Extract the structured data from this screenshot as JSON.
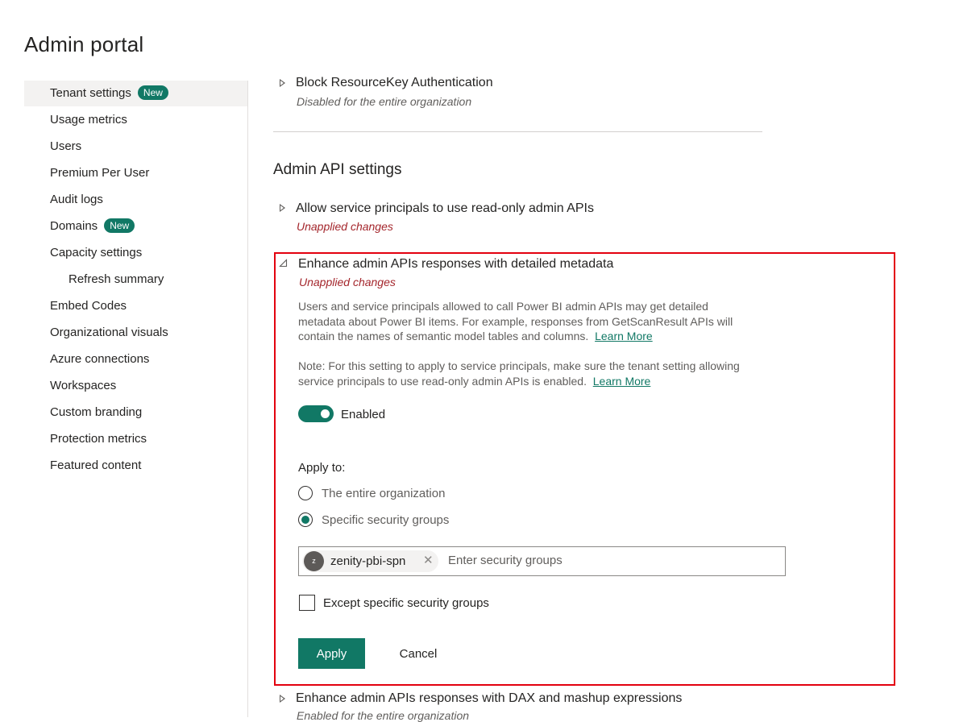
{
  "page": {
    "title": "Admin portal"
  },
  "sidebar": {
    "items": [
      {
        "label": "Tenant settings",
        "badge": "New"
      },
      {
        "label": "Usage metrics"
      },
      {
        "label": "Users"
      },
      {
        "label": "Premium Per User"
      },
      {
        "label": "Audit logs"
      },
      {
        "label": "Domains",
        "badge": "New"
      },
      {
        "label": "Capacity settings"
      },
      {
        "label": "Refresh summary"
      },
      {
        "label": "Embed Codes"
      },
      {
        "label": "Organizational visuals"
      },
      {
        "label": "Azure connections"
      },
      {
        "label": "Workspaces"
      },
      {
        "label": "Custom branding"
      },
      {
        "label": "Protection metrics"
      },
      {
        "label": "Featured content"
      }
    ]
  },
  "main": {
    "prev_setting": {
      "title": "Block ResourceKey Authentication",
      "status": "Disabled for the entire organization"
    },
    "section_heading": "Admin API settings",
    "setting_1": {
      "title": "Allow service principals to use read-only admin APIs",
      "status": "Unapplied changes"
    },
    "setting_2": {
      "title": "Enhance admin APIs responses with detailed metadata",
      "status": "Unapplied changes",
      "desc_1_line_1": "Users and service principals allowed to call Power BI admin APIs may get detailed",
      "desc_1_line_2": "metadata about Power BI items. For example, responses from GetScanResult APIs will",
      "desc_1_line_3": "contain the names of semantic model tables and columns.",
      "desc_1_link": "Learn More",
      "desc_2_line_1": "Note: For this setting to apply to service principals, make sure the tenant setting allowing",
      "desc_2_line_2": "service principals to use read-only admin APIs is enabled.",
      "desc_2_link": "Learn More",
      "toggle_label": "Enabled",
      "apply_to_label": "Apply to:",
      "option_entire_org": "The entire organization",
      "option_specific_groups": "Specific security groups",
      "selected_group": "zenity-pbi-spn",
      "selected_group_initial": "z",
      "group_placeholder": "Enter security groups",
      "except_label": "Except specific security groups",
      "apply_button": "Apply",
      "cancel_button": "Cancel"
    },
    "setting_3": {
      "title": "Enhance admin APIs responses with DAX and mashup expressions",
      "status": "Enabled for the entire organization"
    }
  },
  "colors": {
    "accent": "#117865",
    "highlight_border": "#e3000f",
    "unapplied_text": "#a4262c"
  },
  "icons": {
    "expand": "caret-right-icon",
    "collapse": "caret-down-icon",
    "remove": "close-icon"
  }
}
